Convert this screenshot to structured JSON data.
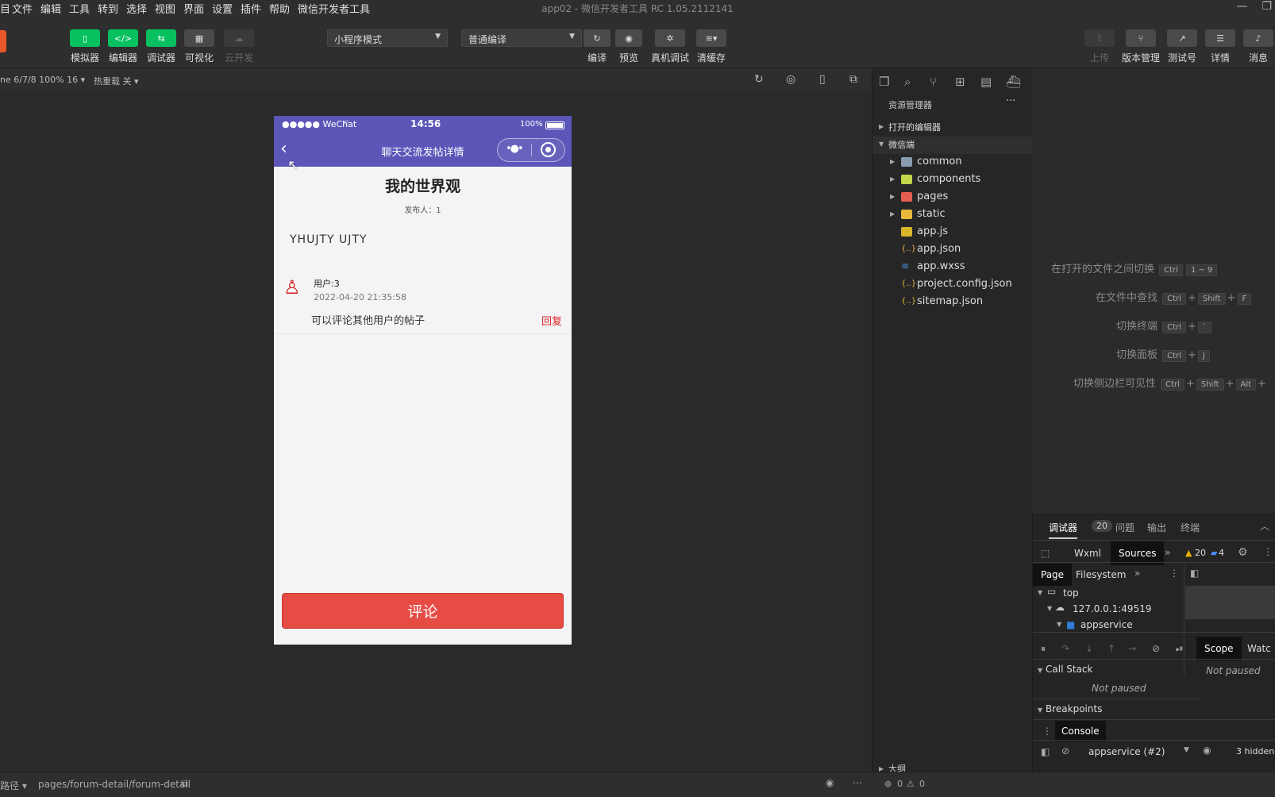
{
  "menu": {
    "items": [
      "目",
      "文件",
      "编辑",
      "工具",
      "转到",
      "选择",
      "视图",
      "界面",
      "设置",
      "插件",
      "帮助",
      "微信开发者工具"
    ],
    "window_title": "app02 - 微信开发者工具 RC 1.05.2112141"
  },
  "toolbar": {
    "simulator": "模拟器",
    "editor": "编辑器",
    "debugger": "调试器",
    "visual": "可视化",
    "cloud": "云开发",
    "mode_select": "小程序模式",
    "compile_select": "普通编译",
    "compile": "编译",
    "preview": "预览",
    "real_debug": "真机调试",
    "clear_cache": "清缓存",
    "upload": "上传",
    "version": "版本管理",
    "test_account": "测试号",
    "details": "详情",
    "messages": "消息"
  },
  "subbar": {
    "device": "ne 6/7/8 100% 16 ▾",
    "hot_reload": "热重载 关 ▾"
  },
  "phone": {
    "status_signal": "●●●●● WeChat",
    "status_time": "14:56",
    "status_battery": "100%",
    "nav_title": "聊天交流发帖详情",
    "post_title": "我的世界观",
    "post_author": "发布人：1",
    "post_body": "YHUJTY UJTY",
    "comment_user": "用户:3",
    "comment_time": "2022-04-20 21:35:58",
    "comment_text": "可以评论其他用户的帖子",
    "reply": "回复",
    "comment_button": "评论"
  },
  "explorer": {
    "title": "资源管理器",
    "more": "···",
    "open_editors": "打开的编辑器",
    "root": "微信端",
    "items": [
      {
        "name": "common",
        "type": "folder",
        "color": "#8a9bb0"
      },
      {
        "name": "components",
        "type": "folder",
        "color": "#c4d64a"
      },
      {
        "name": "pages",
        "type": "folder",
        "color": "#e35d4f"
      },
      {
        "name": "static",
        "type": "folder",
        "color": "#e8b93c"
      },
      {
        "name": "app.js",
        "type": "js",
        "color": "#d8b52a"
      },
      {
        "name": "app.json",
        "type": "json",
        "color": "#e0b040"
      },
      {
        "name": "app.wxss",
        "type": "wxss",
        "color": "#4a90e2"
      },
      {
        "name": "project.config.json",
        "type": "json",
        "color": "#e0b040"
      },
      {
        "name": "sitemap.json",
        "type": "json",
        "color": "#e0b040"
      }
    ],
    "outline": "大纲"
  },
  "shortcuts": [
    {
      "label": "在打开的文件之间切换",
      "keys": [
        "Ctrl",
        "1 ~ 9"
      ]
    },
    {
      "label": "在文件中查找",
      "keys": [
        "Ctrl",
        "+",
        "Shift",
        "+",
        "F"
      ]
    },
    {
      "label": "切换终端",
      "keys": [
        "Ctrl",
        "+",
        "`"
      ]
    },
    {
      "label": "切换面板",
      "keys": [
        "Ctrl",
        "+",
        "J"
      ]
    },
    {
      "label": "切换侧边栏可见性",
      "keys": [
        "Ctrl",
        "+",
        "Shift",
        "+",
        "Alt",
        "+"
      ]
    }
  ],
  "debug": {
    "tab_debugger": "调试器",
    "count": "20",
    "tab_issues": "问题",
    "tab_output": "输出",
    "tab_terminal": "终端",
    "wxml": "Wxml",
    "sources": "Sources",
    "warn_count": "20",
    "info_count": "4",
    "page": "Page",
    "filesystem": "Filesystem",
    "top": "top",
    "host": "127.0.0.1:49519",
    "appservice": "appservice",
    "scope": "Scope",
    "watch": "Watc",
    "not_paused_right": "Not paused",
    "call_stack": "Call Stack",
    "not_paused": "Not paused",
    "breakpoints": "Breakpoints",
    "console": "Console",
    "context": "appservice (#2)",
    "hidden": "3 hidden"
  },
  "statusbar": {
    "path_label": "路径 ▾",
    "path": "pages/forum-detail/forum-detail",
    "errors": "0",
    "warnings": "0"
  }
}
